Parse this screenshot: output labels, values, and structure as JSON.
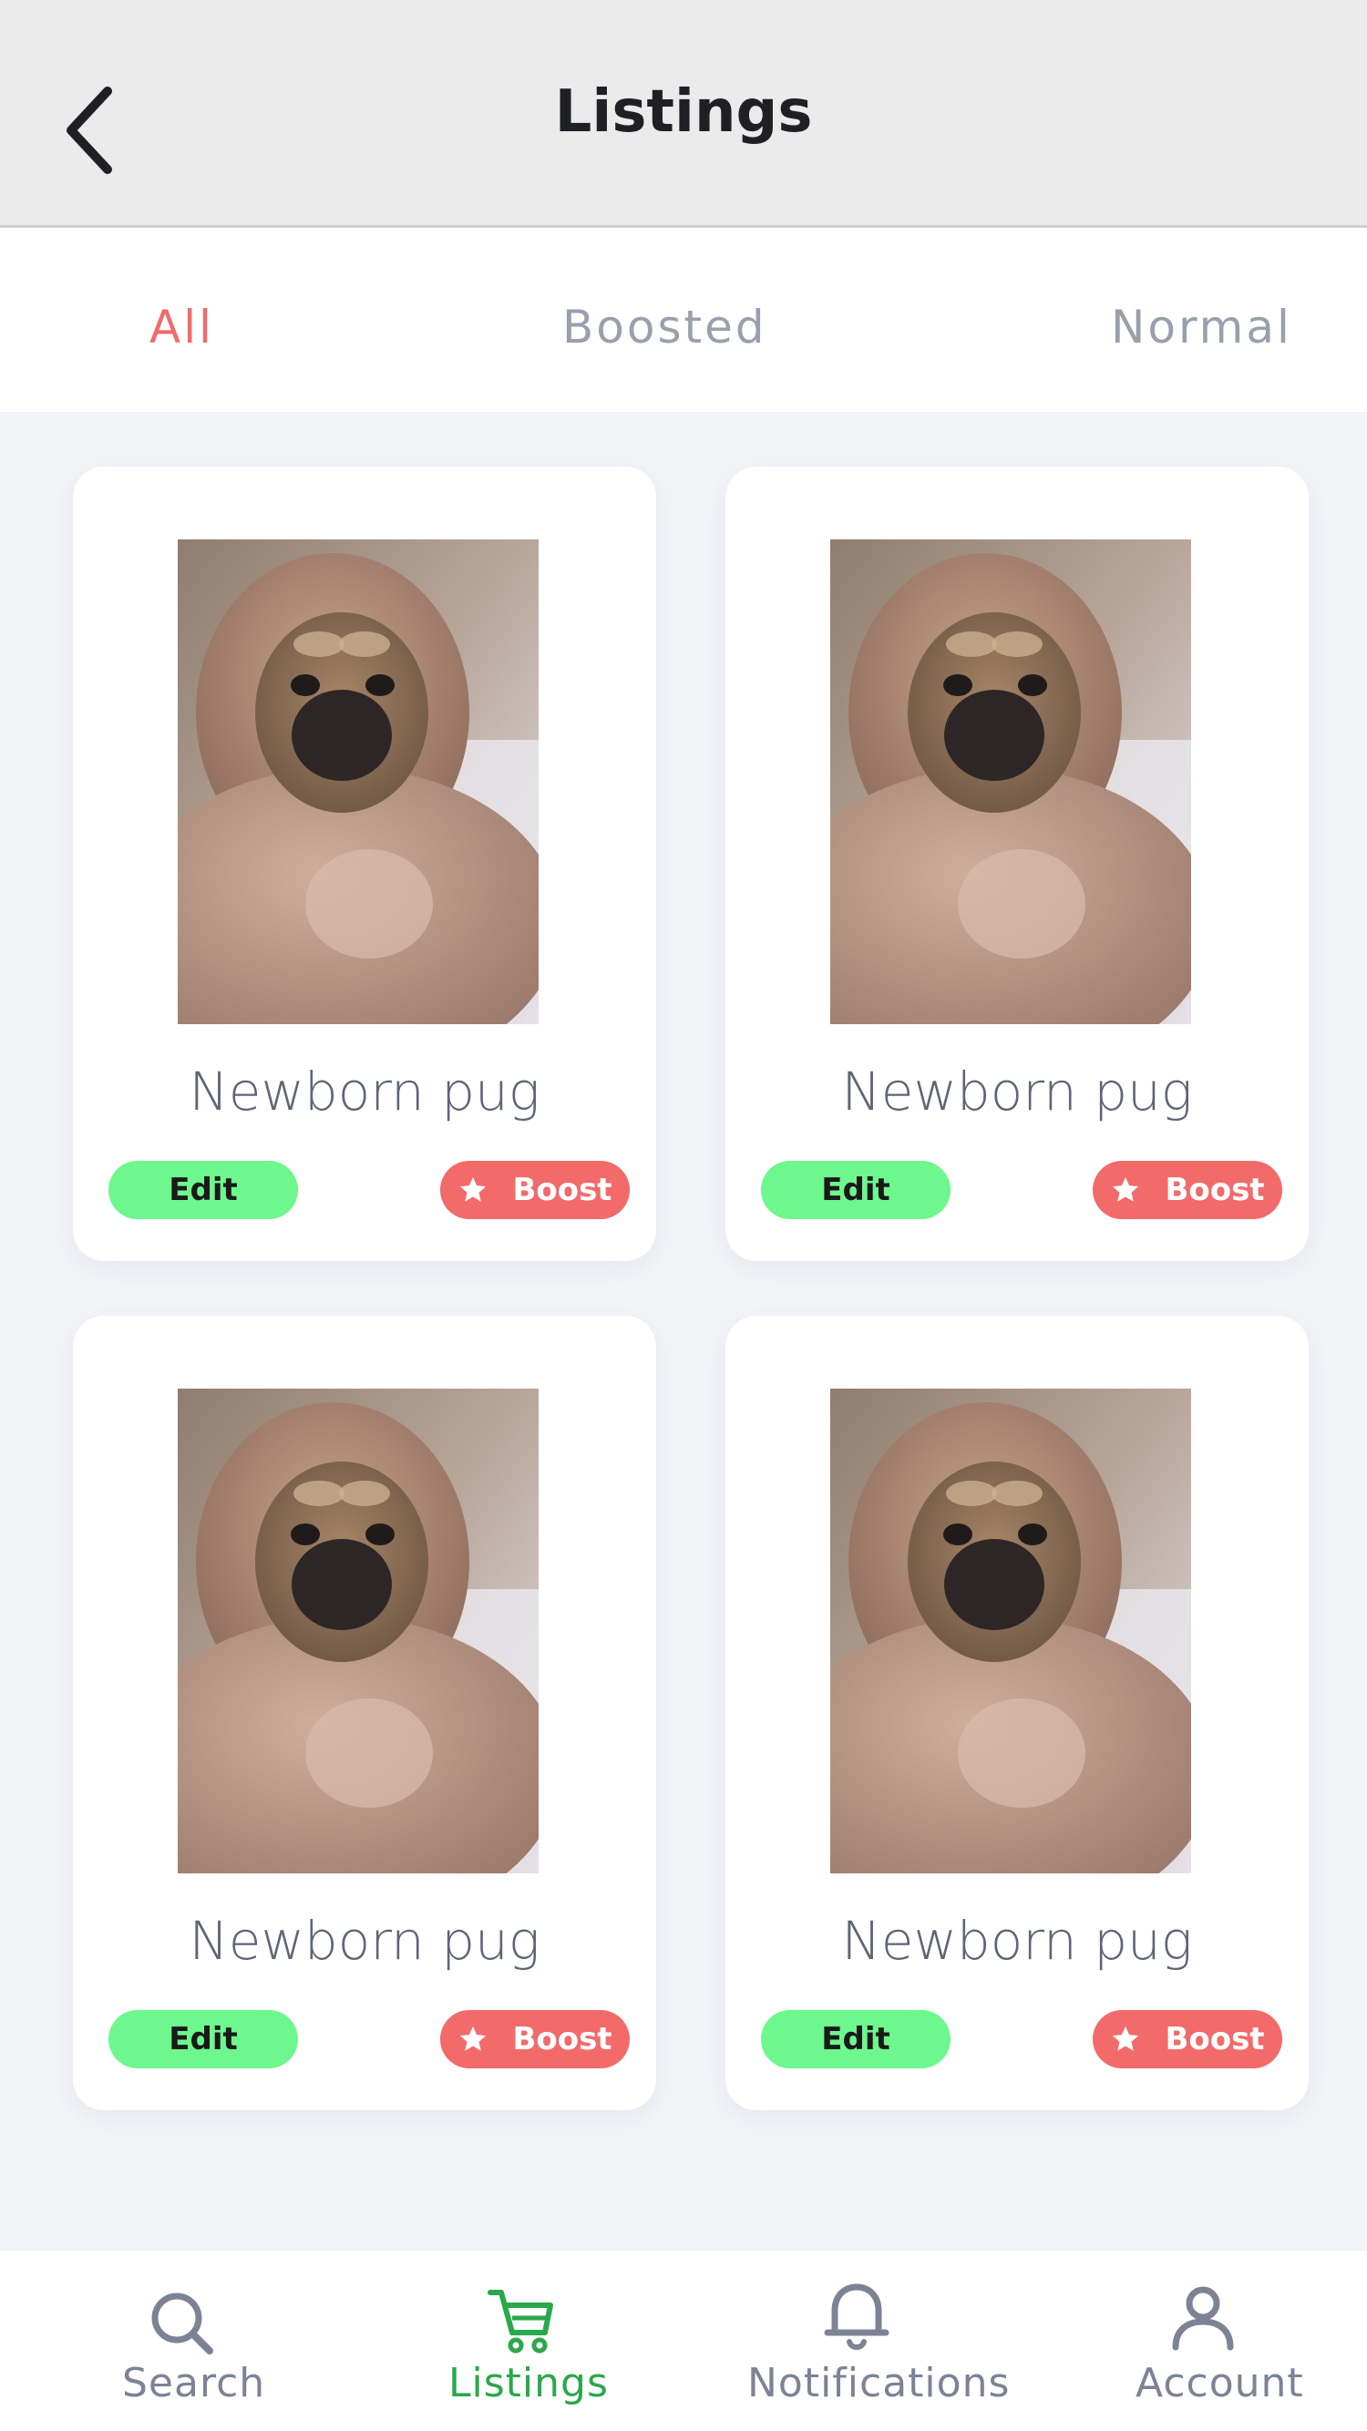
{
  "header": {
    "title": "Listings",
    "back_icon": "chevron-left-icon"
  },
  "tabs": [
    {
      "label": "All",
      "active": true
    },
    {
      "label": "Boosted",
      "active": false
    },
    {
      "label": "Normal",
      "active": false
    }
  ],
  "listings": [
    {
      "title": "Newborn pug",
      "edit_label": "Edit",
      "boost_label": "Boost",
      "image": "pug-in-blanket-photo"
    },
    {
      "title": "Newborn pug",
      "edit_label": "Edit",
      "boost_label": "Boost",
      "image": "pug-in-blanket-photo"
    },
    {
      "title": "Newborn pug",
      "edit_label": "Edit",
      "boost_label": "Boost",
      "image": "pug-in-blanket-photo"
    },
    {
      "title": "Newborn pug",
      "edit_label": "Edit",
      "boost_label": "Boost",
      "image": "pug-in-blanket-photo"
    }
  ],
  "nav": [
    {
      "label": "Search",
      "icon": "search-icon",
      "active": false
    },
    {
      "label": "Listings",
      "icon": "cart-icon",
      "active": true
    },
    {
      "label": "Notifications",
      "icon": "bell-icon",
      "active": false
    },
    {
      "label": "Account",
      "icon": "user-icon",
      "active": false
    }
  ],
  "colors": {
    "accent_red": "#f26a6a",
    "accent_green": "#6df78d",
    "nav_active": "#2aa84a",
    "muted_text": "#9a9fae",
    "background": "#f3f4f8"
  }
}
